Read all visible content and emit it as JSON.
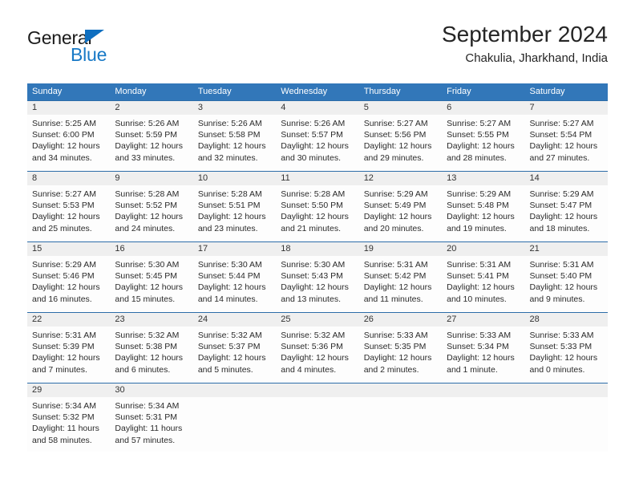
{
  "brand": {
    "name_part1": "General",
    "name_part2": "Blue",
    "triangle_color": "#0f6fc0",
    "blue_color": "#1879c6"
  },
  "header": {
    "title": "September 2024",
    "subtitle": "Chakulia, Jharkhand, India"
  },
  "theme": {
    "header_blue": "#3277b9",
    "row_rule_blue": "#2c6ca8",
    "day_band_gray": "#efefef"
  },
  "weekdays": [
    "Sunday",
    "Monday",
    "Tuesday",
    "Wednesday",
    "Thursday",
    "Friday",
    "Saturday"
  ],
  "weeks": [
    [
      {
        "day": "1",
        "sunrise": "Sunrise: 5:25 AM",
        "sunset": "Sunset: 6:00 PM",
        "daylight1": "Daylight: 12 hours",
        "daylight2": "and 34 minutes."
      },
      {
        "day": "2",
        "sunrise": "Sunrise: 5:26 AM",
        "sunset": "Sunset: 5:59 PM",
        "daylight1": "Daylight: 12 hours",
        "daylight2": "and 33 minutes."
      },
      {
        "day": "3",
        "sunrise": "Sunrise: 5:26 AM",
        "sunset": "Sunset: 5:58 PM",
        "daylight1": "Daylight: 12 hours",
        "daylight2": "and 32 minutes."
      },
      {
        "day": "4",
        "sunrise": "Sunrise: 5:26 AM",
        "sunset": "Sunset: 5:57 PM",
        "daylight1": "Daylight: 12 hours",
        "daylight2": "and 30 minutes."
      },
      {
        "day": "5",
        "sunrise": "Sunrise: 5:27 AM",
        "sunset": "Sunset: 5:56 PM",
        "daylight1": "Daylight: 12 hours",
        "daylight2": "and 29 minutes."
      },
      {
        "day": "6",
        "sunrise": "Sunrise: 5:27 AM",
        "sunset": "Sunset: 5:55 PM",
        "daylight1": "Daylight: 12 hours",
        "daylight2": "and 28 minutes."
      },
      {
        "day": "7",
        "sunrise": "Sunrise: 5:27 AM",
        "sunset": "Sunset: 5:54 PM",
        "daylight1": "Daylight: 12 hours",
        "daylight2": "and 27 minutes."
      }
    ],
    [
      {
        "day": "8",
        "sunrise": "Sunrise: 5:27 AM",
        "sunset": "Sunset: 5:53 PM",
        "daylight1": "Daylight: 12 hours",
        "daylight2": "and 25 minutes."
      },
      {
        "day": "9",
        "sunrise": "Sunrise: 5:28 AM",
        "sunset": "Sunset: 5:52 PM",
        "daylight1": "Daylight: 12 hours",
        "daylight2": "and 24 minutes."
      },
      {
        "day": "10",
        "sunrise": "Sunrise: 5:28 AM",
        "sunset": "Sunset: 5:51 PM",
        "daylight1": "Daylight: 12 hours",
        "daylight2": "and 23 minutes."
      },
      {
        "day": "11",
        "sunrise": "Sunrise: 5:28 AM",
        "sunset": "Sunset: 5:50 PM",
        "daylight1": "Daylight: 12 hours",
        "daylight2": "and 21 minutes."
      },
      {
        "day": "12",
        "sunrise": "Sunrise: 5:29 AM",
        "sunset": "Sunset: 5:49 PM",
        "daylight1": "Daylight: 12 hours",
        "daylight2": "and 20 minutes."
      },
      {
        "day": "13",
        "sunrise": "Sunrise: 5:29 AM",
        "sunset": "Sunset: 5:48 PM",
        "daylight1": "Daylight: 12 hours",
        "daylight2": "and 19 minutes."
      },
      {
        "day": "14",
        "sunrise": "Sunrise: 5:29 AM",
        "sunset": "Sunset: 5:47 PM",
        "daylight1": "Daylight: 12 hours",
        "daylight2": "and 18 minutes."
      }
    ],
    [
      {
        "day": "15",
        "sunrise": "Sunrise: 5:29 AM",
        "sunset": "Sunset: 5:46 PM",
        "daylight1": "Daylight: 12 hours",
        "daylight2": "and 16 minutes."
      },
      {
        "day": "16",
        "sunrise": "Sunrise: 5:30 AM",
        "sunset": "Sunset: 5:45 PM",
        "daylight1": "Daylight: 12 hours",
        "daylight2": "and 15 minutes."
      },
      {
        "day": "17",
        "sunrise": "Sunrise: 5:30 AM",
        "sunset": "Sunset: 5:44 PM",
        "daylight1": "Daylight: 12 hours",
        "daylight2": "and 14 minutes."
      },
      {
        "day": "18",
        "sunrise": "Sunrise: 5:30 AM",
        "sunset": "Sunset: 5:43 PM",
        "daylight1": "Daylight: 12 hours",
        "daylight2": "and 13 minutes."
      },
      {
        "day": "19",
        "sunrise": "Sunrise: 5:31 AM",
        "sunset": "Sunset: 5:42 PM",
        "daylight1": "Daylight: 12 hours",
        "daylight2": "and 11 minutes."
      },
      {
        "day": "20",
        "sunrise": "Sunrise: 5:31 AM",
        "sunset": "Sunset: 5:41 PM",
        "daylight1": "Daylight: 12 hours",
        "daylight2": "and 10 minutes."
      },
      {
        "day": "21",
        "sunrise": "Sunrise: 5:31 AM",
        "sunset": "Sunset: 5:40 PM",
        "daylight1": "Daylight: 12 hours",
        "daylight2": "and 9 minutes."
      }
    ],
    [
      {
        "day": "22",
        "sunrise": "Sunrise: 5:31 AM",
        "sunset": "Sunset: 5:39 PM",
        "daylight1": "Daylight: 12 hours",
        "daylight2": "and 7 minutes."
      },
      {
        "day": "23",
        "sunrise": "Sunrise: 5:32 AM",
        "sunset": "Sunset: 5:38 PM",
        "daylight1": "Daylight: 12 hours",
        "daylight2": "and 6 minutes."
      },
      {
        "day": "24",
        "sunrise": "Sunrise: 5:32 AM",
        "sunset": "Sunset: 5:37 PM",
        "daylight1": "Daylight: 12 hours",
        "daylight2": "and 5 minutes."
      },
      {
        "day": "25",
        "sunrise": "Sunrise: 5:32 AM",
        "sunset": "Sunset: 5:36 PM",
        "daylight1": "Daylight: 12 hours",
        "daylight2": "and 4 minutes."
      },
      {
        "day": "26",
        "sunrise": "Sunrise: 5:33 AM",
        "sunset": "Sunset: 5:35 PM",
        "daylight1": "Daylight: 12 hours",
        "daylight2": "and 2 minutes."
      },
      {
        "day": "27",
        "sunrise": "Sunrise: 5:33 AM",
        "sunset": "Sunset: 5:34 PM",
        "daylight1": "Daylight: 12 hours",
        "daylight2": "and 1 minute."
      },
      {
        "day": "28",
        "sunrise": "Sunrise: 5:33 AM",
        "sunset": "Sunset: 5:33 PM",
        "daylight1": "Daylight: 12 hours",
        "daylight2": "and 0 minutes."
      }
    ],
    [
      {
        "day": "29",
        "sunrise": "Sunrise: 5:34 AM",
        "sunset": "Sunset: 5:32 PM",
        "daylight1": "Daylight: 11 hours",
        "daylight2": "and 58 minutes."
      },
      {
        "day": "30",
        "sunrise": "Sunrise: 5:34 AM",
        "sunset": "Sunset: 5:31 PM",
        "daylight1": "Daylight: 11 hours",
        "daylight2": "and 57 minutes."
      },
      {
        "day": "",
        "sunrise": "",
        "sunset": "",
        "daylight1": "",
        "daylight2": ""
      },
      {
        "day": "",
        "sunrise": "",
        "sunset": "",
        "daylight1": "",
        "daylight2": ""
      },
      {
        "day": "",
        "sunrise": "",
        "sunset": "",
        "daylight1": "",
        "daylight2": ""
      },
      {
        "day": "",
        "sunrise": "",
        "sunset": "",
        "daylight1": "",
        "daylight2": ""
      },
      {
        "day": "",
        "sunrise": "",
        "sunset": "",
        "daylight1": "",
        "daylight2": ""
      }
    ]
  ]
}
